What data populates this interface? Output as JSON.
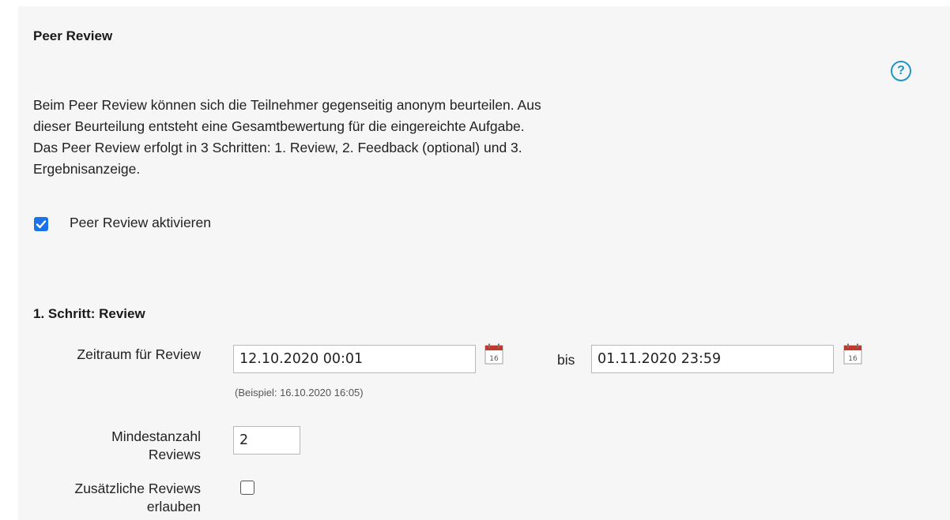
{
  "section": {
    "title": "Peer Review",
    "help_icon": "help-circle-icon",
    "description_lines": [
      "Beim Peer Review können sich die Teilnehmer gegenseitig anonym beurteilen. Aus",
      "dieser Beurteilung entsteht eine Gesamtbewertung für die eingereichte Aufgabe.",
      "Das Peer Review erfolgt in 3 Schritten: 1. Review, 2. Feedback (optional) und 3.",
      "Ergebnisanzeige."
    ],
    "activate": {
      "label": "Peer Review aktivieren",
      "checked": true
    }
  },
  "step1": {
    "title": "1. Schritt: Review",
    "period": {
      "label": "Zeitraum für Review",
      "start_value": "12.10.2020 00:01",
      "separator": "bis",
      "end_value": "01.11.2020 23:59",
      "calendar_day": "16",
      "hint": "(Beispiel: 16.10.2020 16:05)"
    },
    "min_reviews": {
      "label_line1": "Mindestanzahl",
      "label_line2": "Reviews",
      "value": "2"
    },
    "extra_reviews": {
      "label_line1": "Zusätzliche Reviews",
      "label_line2": "erlauben",
      "checked": false
    }
  },
  "colors": {
    "accent": "#1a73e8",
    "help": "#2196c6",
    "calendar": "#c0392b",
    "panel": "#f6f6f6"
  }
}
